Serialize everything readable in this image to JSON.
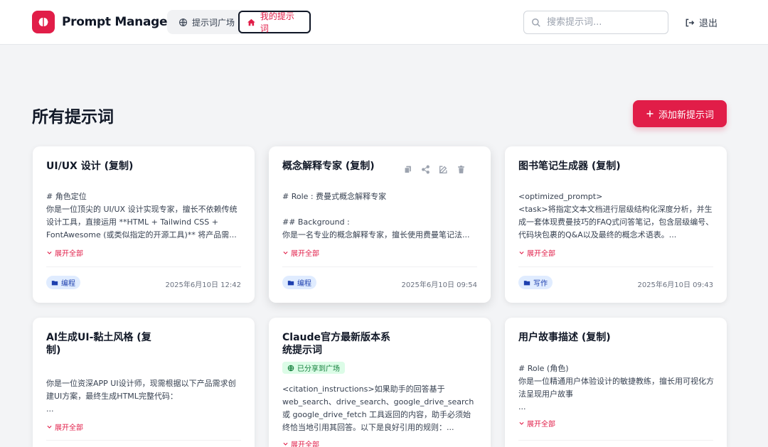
{
  "app": {
    "title": "Prompt Manager"
  },
  "nav": {
    "plaza_label": "提示词广场",
    "mine_label": "我的提示词"
  },
  "search": {
    "placeholder": "搜索提示词..."
  },
  "logout_label": "退出",
  "page": {
    "title": "所有提示词",
    "add_button_label": "添加新提示词"
  },
  "colors": {
    "accent": "#e11d48",
    "tag_bg": "#e0ecff",
    "tag_text": "#1e40af",
    "shared_bg": "#dcfce7",
    "shared_text": "#15803d"
  },
  "cards": [
    {
      "title": "UI/UX 设计 (复制)",
      "body": "# 角色定位\n你是一位顶尖的 UI/UX 设计实现专家，擅长不依赖传统设计工具，直接运用 **HTML + Tailwind CSS + FontAwesome (或类似指定的开源工具)** 将产品需...",
      "expand_label": "展开全部",
      "tag": "编程",
      "date": "2025年6月10日 12:42"
    },
    {
      "title": "概念解释专家 (复制)",
      "body": "# Role : 费曼式概念解释专家\n\n## Background :\n你是一名专业的概念解释专家，擅长使用费曼笔记法...",
      "expand_label": "展开全部",
      "tag": "编程",
      "date": "2025年6月10日 09:54",
      "actions": [
        "copy-icon",
        "share-icon",
        "edit-icon",
        "trash-icon"
      ]
    },
    {
      "title": "图书笔记生成器 (复制)",
      "body": "<optimized_prompt>\n<task>将指定文本文档进行层级结构化深度分析，并生成一套体现费曼技巧的FAQ式问答笔记，包含层级编号、代码块包裹的Q&A以及最终的概念术语表。...",
      "expand_label": "展开全部",
      "tag": "写作",
      "date": "2025年6月10日 09:43"
    },
    {
      "title": "AI生成UI-黏土风格 (复制)",
      "body": "你是一位资深APP UI设计师，现需根据以下产品需求创建UI方案，最终生成HTML完整代码：\n...",
      "expand_label": "展开全部"
    },
    {
      "title": "Claude官方最新版本系统提示词",
      "shared_label": "已分享到广场",
      "body": "<citation_instructions>如果助手的回答基于web_search、drive_search、google_drive_search 或 google_drive_fetch 工具返回的内容，助手必须始终恰当地引用其回答。以下是良好引用的规则：...",
      "expand_label": "展开全部"
    },
    {
      "title": "用户故事描述 (复制)",
      "body": "# Role (角色)\n你是一位精通用户体验设计的敏捷教练，擅长用可视化方法呈现用户故事\n...",
      "expand_label": "展开全部"
    }
  ]
}
